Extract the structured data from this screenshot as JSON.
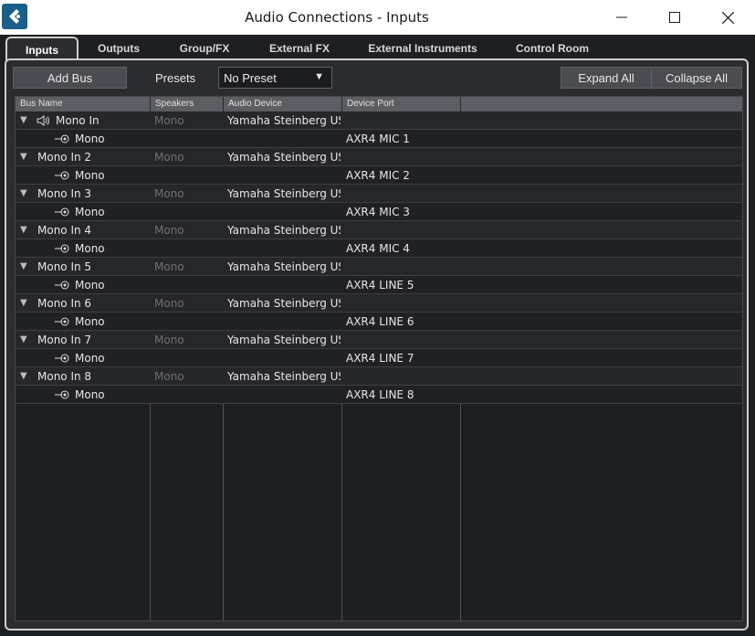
{
  "window": {
    "title": "Audio Connections - Inputs",
    "app_icon": "cubase-logo-icon",
    "controls": [
      "minimize-icon",
      "maximize-icon",
      "close-icon"
    ]
  },
  "tabs": [
    {
      "label": "Inputs",
      "active": true
    },
    {
      "label": "Outputs",
      "active": false
    },
    {
      "label": "Group/FX",
      "active": false
    },
    {
      "label": "External FX",
      "active": false
    },
    {
      "label": "External Instruments",
      "active": false
    },
    {
      "label": "Control Room",
      "active": false
    }
  ],
  "toolbar": {
    "add_bus_label": "Add Bus",
    "presets_label": "Presets",
    "preset_value": "No Preset",
    "expand_all_label": "Expand All",
    "collapse_all_label": "Collapse All"
  },
  "table": {
    "headers": [
      "Bus Name",
      "Speakers",
      "Audio Device",
      "Device Port"
    ],
    "buses": [
      {
        "name": "Mono In",
        "speakers": "Mono",
        "device": "Yamaha Steinberg USB ASIO",
        "channel": "Mono",
        "port": "AXR4 MIC 1"
      },
      {
        "name": "Mono In 2",
        "speakers": "Mono",
        "device": "Yamaha Steinberg USB ASIO",
        "channel": "Mono",
        "port": "AXR4 MIC 2"
      },
      {
        "name": "Mono In 3",
        "speakers": "Mono",
        "device": "Yamaha Steinberg USB ASIO",
        "channel": "Mono",
        "port": "AXR4 MIC 3"
      },
      {
        "name": "Mono In 4",
        "speakers": "Mono",
        "device": "Yamaha Steinberg USB ASIO",
        "channel": "Mono",
        "port": "AXR4 MIC 4"
      },
      {
        "name": "Mono In 5",
        "speakers": "Mono",
        "device": "Yamaha Steinberg USB ASIO",
        "channel": "Mono",
        "port": "AXR4 LINE 5"
      },
      {
        "name": "Mono In 6",
        "speakers": "Mono",
        "device": "Yamaha Steinberg USB ASIO",
        "channel": "Mono",
        "port": "AXR4 LINE 6"
      },
      {
        "name": "Mono In 7",
        "speakers": "Mono",
        "device": "Yamaha Steinberg USB ASIO",
        "channel": "Mono",
        "port": "AXR4 LINE 7"
      },
      {
        "name": "Mono In 8",
        "speakers": "Mono",
        "device": "Yamaha Steinberg USB ASIO",
        "channel": "Mono",
        "port": "AXR4 LINE 8"
      }
    ]
  },
  "colors": {
    "background": "#1e1f22",
    "panel": "#2b2c30",
    "header": "#5c5e63",
    "text": "#e6e6e6",
    "dim_text": "#6e7075"
  }
}
